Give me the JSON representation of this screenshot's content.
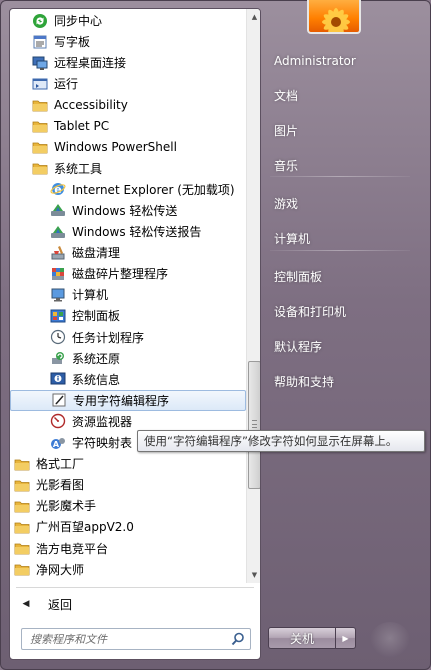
{
  "program_list": [
    {
      "label": "同步中心",
      "icon": "sync-center-icon",
      "indent": 1
    },
    {
      "label": "写字板",
      "icon": "wordpad-icon",
      "indent": 1
    },
    {
      "label": "远程桌面连接",
      "icon": "remote-desktop-icon",
      "indent": 1
    },
    {
      "label": "运行",
      "icon": "run-icon",
      "indent": 1
    },
    {
      "label": "Accessibility",
      "icon": "folder-icon",
      "indent": 1
    },
    {
      "label": "Tablet PC",
      "icon": "folder-icon",
      "indent": 1
    },
    {
      "label": "Windows PowerShell",
      "icon": "folder-icon",
      "indent": 1
    },
    {
      "label": "系统工具",
      "icon": "folder-icon",
      "indent": 1
    },
    {
      "label": "Internet Explorer (无加载项)",
      "icon": "internet-explorer-icon",
      "indent": 2
    },
    {
      "label": "Windows 轻松传送",
      "icon": "easy-transfer-icon",
      "indent": 2
    },
    {
      "label": "Windows 轻松传送报告",
      "icon": "easy-transfer-report-icon",
      "indent": 2
    },
    {
      "label": "磁盘清理",
      "icon": "disk-cleanup-icon",
      "indent": 2
    },
    {
      "label": "磁盘碎片整理程序",
      "icon": "disk-defragmenter-icon",
      "indent": 2
    },
    {
      "label": "计算机",
      "icon": "computer-icon",
      "indent": 2
    },
    {
      "label": "控制面板",
      "icon": "control-panel-icon",
      "indent": 2
    },
    {
      "label": "任务计划程序",
      "icon": "task-scheduler-icon",
      "indent": 2
    },
    {
      "label": "系统还原",
      "icon": "system-restore-icon",
      "indent": 2
    },
    {
      "label": "系统信息",
      "icon": "system-information-icon",
      "indent": 2
    },
    {
      "label": "专用字符编辑程序",
      "icon": "private-character-editor-icon",
      "indent": 2,
      "selected": true
    },
    {
      "label": "资源监视器",
      "icon": "resource-monitor-icon",
      "indent": 2
    },
    {
      "label": "字符映射表",
      "icon": "character-map-icon",
      "indent": 2
    },
    {
      "label": "格式工厂",
      "icon": "folder-icon",
      "indent": 0
    },
    {
      "label": "光影看图",
      "icon": "folder-icon",
      "indent": 0
    },
    {
      "label": "光影魔术手",
      "icon": "folder-icon",
      "indent": 0
    },
    {
      "label": "广州百望appV2.0",
      "icon": "folder-icon",
      "indent": 0
    },
    {
      "label": "浩方电竞平台",
      "icon": "folder-icon",
      "indent": 0
    },
    {
      "label": "净网大师",
      "icon": "folder-icon",
      "indent": 0
    }
  ],
  "back_label": "返回",
  "search": {
    "placeholder": "搜索程序和文件"
  },
  "right_pane": [
    {
      "label": "Administrator",
      "name": "right-item-administrator"
    },
    {
      "label": "文档",
      "name": "right-item-documents"
    },
    {
      "label": "图片",
      "name": "right-item-pictures"
    },
    {
      "label": "音乐",
      "name": "right-item-music"
    },
    {
      "label": "游戏",
      "name": "right-item-games"
    },
    {
      "label": "计算机",
      "name": "right-item-computer"
    },
    {
      "label": "控制面板",
      "name": "right-item-control-panel"
    },
    {
      "label": "设备和打印机",
      "name": "right-item-devices-printers"
    },
    {
      "label": "默认程序",
      "name": "right-item-default-programs"
    },
    {
      "label": "帮助和支持",
      "name": "right-item-help-support"
    }
  ],
  "shutdown_label": "关机",
  "tooltip": "使用“字符编辑程序”修改字符如何显示在屏幕上。",
  "colors": {
    "folder": "#e8b53c",
    "selection_border": "#9dbbe0",
    "right_pane_text": "#ffffff"
  }
}
